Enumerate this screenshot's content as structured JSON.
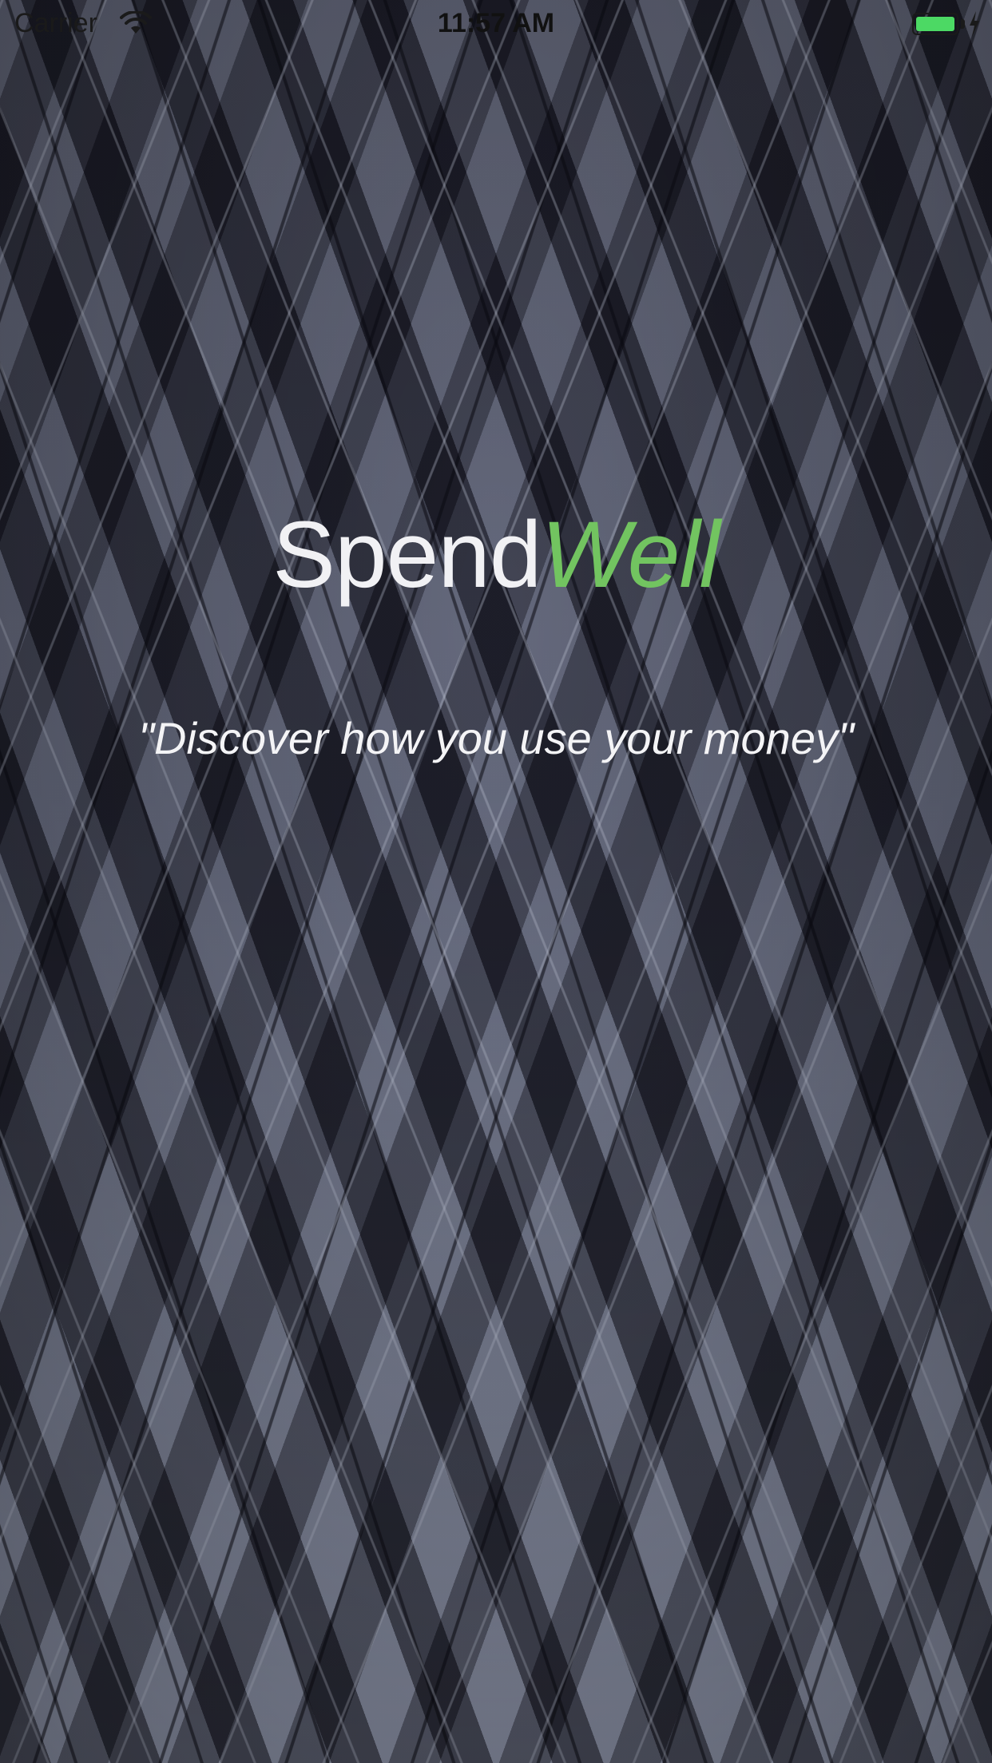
{
  "status_bar": {
    "carrier": "Carrier",
    "time": "11:57 AM",
    "battery_color": "#4cd964"
  },
  "brand": {
    "part1": "Spend",
    "part2": "Well",
    "part1_color": "#f1f1f4",
    "part2_color": "#72c460"
  },
  "tagline": "\"Discover how you use your money\"",
  "icons": {
    "wifi": "wifi-icon",
    "battery": "battery-icon",
    "charging": "charging-bolt-icon"
  }
}
